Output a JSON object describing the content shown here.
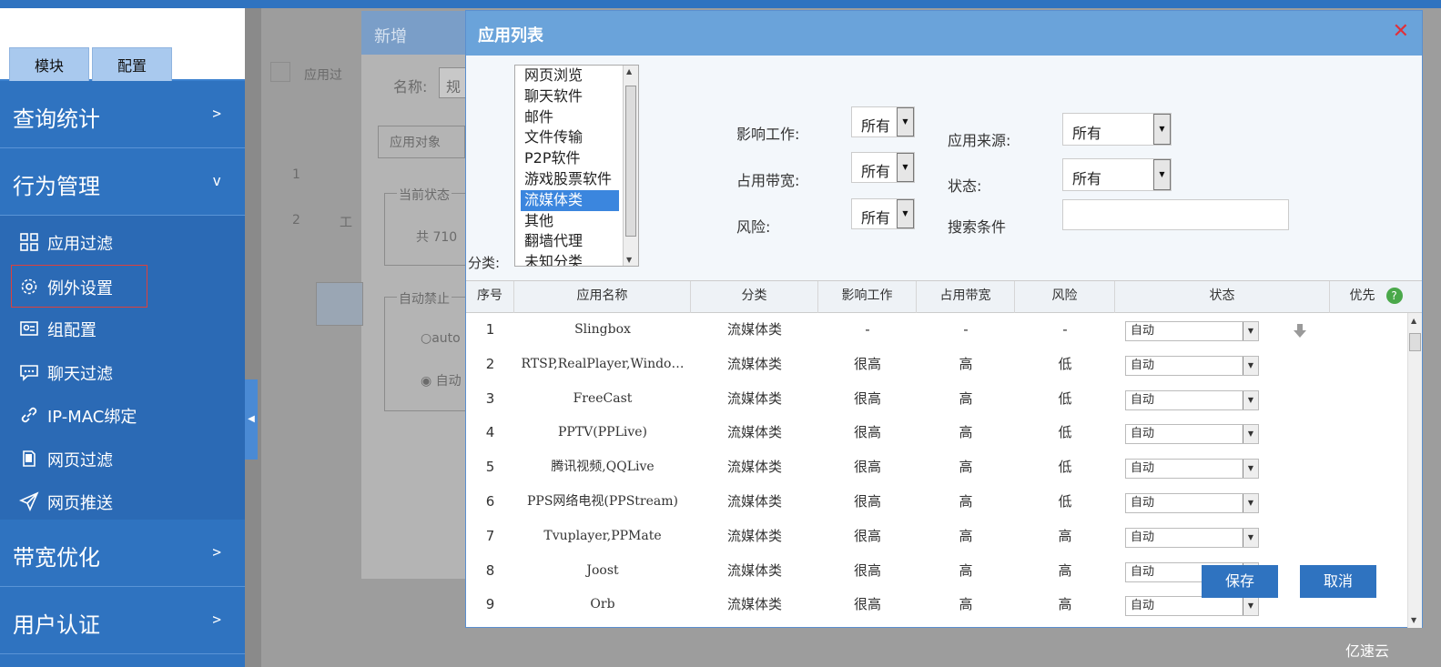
{
  "sidebar": {
    "tabs": [
      "模块",
      "配置"
    ],
    "sections_top": [
      {
        "label": "查询统计",
        "arrow": ">"
      },
      {
        "label": "行为管理",
        "arrow": "v"
      }
    ],
    "items": [
      {
        "label": "应用过滤",
        "icon": "grid-icon"
      },
      {
        "label": "例外设置",
        "icon": "gear-icon"
      },
      {
        "label": "组配置",
        "icon": "id-card-icon"
      },
      {
        "label": "聊天过滤",
        "icon": "chat-icon"
      },
      {
        "label": "IP-MAC绑定",
        "icon": "link-icon"
      },
      {
        "label": "网页过滤",
        "icon": "page-icon"
      },
      {
        "label": "网页推送",
        "icon": "send-icon"
      }
    ],
    "sections_bottom": [
      {
        "label": "带宽优化",
        "arrow": ">"
      },
      {
        "label": "用户认证",
        "arrow": ">"
      }
    ]
  },
  "background": {
    "dialog_title": "新增",
    "app_filter": "应用过",
    "name_label": "名称:",
    "name_value": "规",
    "tab_app_obj": "应用对象",
    "row1": "1",
    "row2": "2",
    "row2_text": "工",
    "status_label": "当前状态",
    "total_text": "共 710",
    "auto_ban": "自动禁止",
    "radio_auto": "auto",
    "radio_auto2": "自动"
  },
  "dialog": {
    "title": "应用列表",
    "close": "✕",
    "category_label": "分类:",
    "categories": [
      "网页浏览",
      "聊天软件",
      "邮件",
      "文件传输",
      "P2P软件",
      "游戏股票软件",
      "流媒体类",
      "其他",
      "翻墙代理",
      "未知分类"
    ],
    "selected_category": "流媒体类",
    "filters": {
      "work_label": "影响工作:",
      "work_value": "所有",
      "bandwidth_label": "占用带宽:",
      "bandwidth_value": "所有",
      "risk_label": "风险:",
      "risk_value": "所有",
      "source_label": "应用来源:",
      "source_value": "所有",
      "status_label": "状态:",
      "status_value": "所有",
      "search_label": "搜索条件",
      "search_value": ""
    },
    "columns": [
      "序号",
      "应用名称",
      "分类",
      "影响工作",
      "占用带宽",
      "风险",
      "状态",
      "优先"
    ],
    "help_icon": "?",
    "rows": [
      {
        "no": "1",
        "name": "Slingbox",
        "cat": "流媒体类",
        "work": "-",
        "bw": "-",
        "risk": "-",
        "status": "自动"
      },
      {
        "no": "2",
        "name": "RTSP,RealPlayer,Windo…",
        "cat": "流媒体类",
        "work": "很高",
        "bw": "高",
        "risk": "低",
        "status": "自动"
      },
      {
        "no": "3",
        "name": "FreeCast",
        "cat": "流媒体类",
        "work": "很高",
        "bw": "高",
        "risk": "低",
        "status": "自动"
      },
      {
        "no": "4",
        "name": "PPTV(PPLive)",
        "cat": "流媒体类",
        "work": "很高",
        "bw": "高",
        "risk": "低",
        "status": "自动"
      },
      {
        "no": "5",
        "name": "腾讯视频,QQLive",
        "cat": "流媒体类",
        "work": "很高",
        "bw": "高",
        "risk": "低",
        "status": "自动"
      },
      {
        "no": "6",
        "name": "PPS网络电视(PPStream)",
        "cat": "流媒体类",
        "work": "很高",
        "bw": "高",
        "risk": "低",
        "status": "自动"
      },
      {
        "no": "7",
        "name": "Tvuplayer,PPMate",
        "cat": "流媒体类",
        "work": "很高",
        "bw": "高",
        "risk": "高",
        "status": "自动"
      },
      {
        "no": "8",
        "name": "Joost",
        "cat": "流媒体类",
        "work": "很高",
        "bw": "高",
        "risk": "高",
        "status": "自动"
      },
      {
        "no": "9",
        "name": "Orb",
        "cat": "流媒体类",
        "work": "很高",
        "bw": "高",
        "risk": "高",
        "status": "自动"
      }
    ],
    "save_label": "保存",
    "cancel_label": "取消"
  },
  "watermark": "亿速云"
}
